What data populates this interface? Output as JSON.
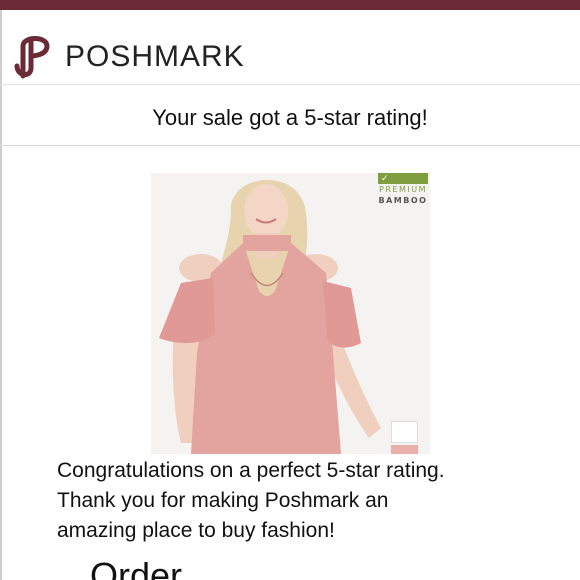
{
  "brand": {
    "name": "POSHMARK",
    "color": "#6b2a35",
    "logo_icon": "poshmark-logo-icon"
  },
  "headline": "Your sale got a 5-star rating!",
  "product": {
    "image_icon": "pink-cold-shoulder-top-photo",
    "badge": {
      "line1": "PREMIUM",
      "line2": "BAMBOO",
      "color": "#7f9e3f"
    },
    "swatches": [
      "#ffffff",
      "#e9b0ab"
    ]
  },
  "message": {
    "line1": "Congratulations on a perfect 5-star rating.",
    "line2": "Thank you for making Poshmark an",
    "line3": "amazing place to buy fashion!"
  },
  "section_heading": "Order"
}
